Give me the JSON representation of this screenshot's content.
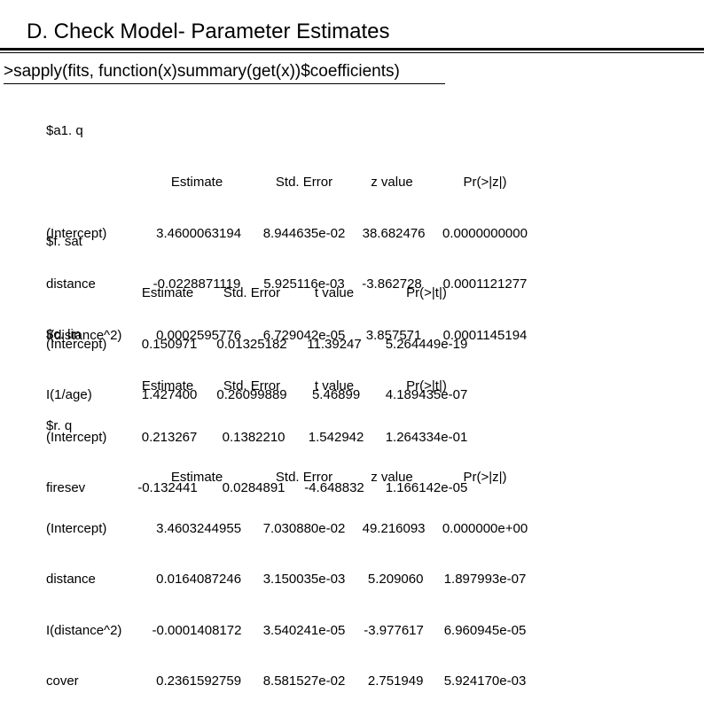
{
  "title": "D. Check Model- Parameter Estimates",
  "codeline": ">sapply(fits, function(x)summary(get(x))$coefficients)",
  "groups": [
    {
      "name": "$a1. q",
      "headers": [
        "Estimate",
        "Std. Error",
        "z value",
        "Pr(>|z|)"
      ],
      "wide": true,
      "rows": [
        {
          "term": "(Intercept)",
          "est": " 3.4600063194",
          "se": "8.944635e-02",
          "z": " 38.682476",
          "p": "0.0000000000"
        },
        {
          "term": "distance",
          "est": "-0.0228871119",
          "se": "5.925116e-03",
          "z": "-3.862728",
          "p": "0.0001121277"
        },
        {
          "term": "I(distance^2)",
          "est": " 0.0002595776",
          "se": "6.729042e-05",
          "z": " 3.857571",
          "p": "0.0001145194"
        }
      ]
    },
    {
      "name": "$f. sat",
      "headers": [
        "Estimate",
        "Std. Error",
        "t value",
        "Pr(>|t|)"
      ],
      "wide": false,
      "rows": [
        {
          "term": "(Intercept)",
          "est": " 0.150971",
          "se": "0.01325182",
          "z": "11.39247",
          "p": "5.264449e-19"
        },
        {
          "term": "I(1/age)",
          "est": " 1.427400",
          "se": "0.26099889",
          "z": " 5.46899",
          "p": "4.189435e-07"
        }
      ]
    },
    {
      "name": "$c. lin",
      "headers": [
        "Estimate",
        "Std. Error",
        "t value",
        "Pr(>|t|)"
      ],
      "wide": false,
      "rows": [
        {
          "term": "(Intercept)",
          "est": " 0.213267",
          "se": " 0.1382210",
          "z": " 1.542942",
          "p": "1.264334e-01"
        },
        {
          "term": "firesev",
          "est": "-0.132441",
          "se": " 0.0284891",
          "z": "-4.648832",
          "p": "1.166142e-05"
        }
      ]
    },
    {
      "name": "$r. q",
      "headers": [
        "Estimate",
        "Std. Error",
        "z value",
        "Pr(>|z|)"
      ],
      "wide": true,
      "rows": [
        {
          "term": "(Intercept)",
          "est": " 3.4603244955",
          "se": "7.030880e-02",
          "z": " 49.216093",
          "p": "0.000000e+00"
        },
        {
          "term": "distance",
          "est": " 0.0164087246",
          "se": "3.150035e-03",
          "z": "  5.209060",
          "p": "1.897993e-07"
        },
        {
          "term": "I(distance^2)",
          "est": "-0.0001408172",
          "se": "3.540241e-05",
          "z": " -3.977617",
          "p": "6.960945e-05"
        },
        {
          "term": "cover",
          "est": " 0.2361592759",
          "se": "8.581527e-02",
          "z": "  2.751949",
          "p": "5.924170e-03"
        }
      ]
    }
  ]
}
